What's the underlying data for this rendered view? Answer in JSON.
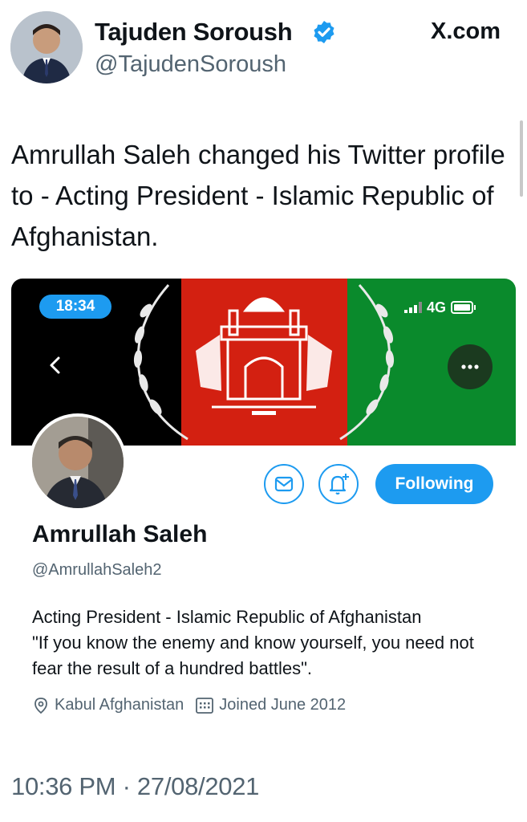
{
  "author": {
    "name": "Tajuden Soroush",
    "handle": "@TajudenSoroush"
  },
  "source_label": "X.com",
  "tweet": {
    "text": "Amrullah Saleh changed his Twitter profile to - Acting President - Islamic Republic of Afghanistan.",
    "timestamp": "10:36 PM · 27/08/2021"
  },
  "embedded": {
    "status_bar": {
      "time": "18:34",
      "network": "4G"
    },
    "follow_button_label": "Following",
    "profile": {
      "name": "Amrullah Saleh",
      "handle": "@AmrullahSaleh2",
      "bio": "Acting President - Islamic Republic of Afghanistan\n\"If you know the enemy and know yourself, you need not fear the result of a hundred battles\".",
      "location": "Kabul Afghanistan",
      "joined": "Joined June 2012"
    },
    "banner_colors": {
      "left": "#000000",
      "center": "#d32011",
      "right": "#0a8a2c"
    }
  },
  "colors": {
    "accent": "#1d9bf0",
    "text": "#0f1419",
    "muted": "#536471"
  },
  "icons": [
    "verified-badge-icon",
    "back-chevron-icon",
    "more-dots-icon",
    "mail-icon",
    "bell-plus-icon",
    "location-pin-icon",
    "calendar-icon",
    "signal-bars-icon",
    "battery-icon"
  ]
}
